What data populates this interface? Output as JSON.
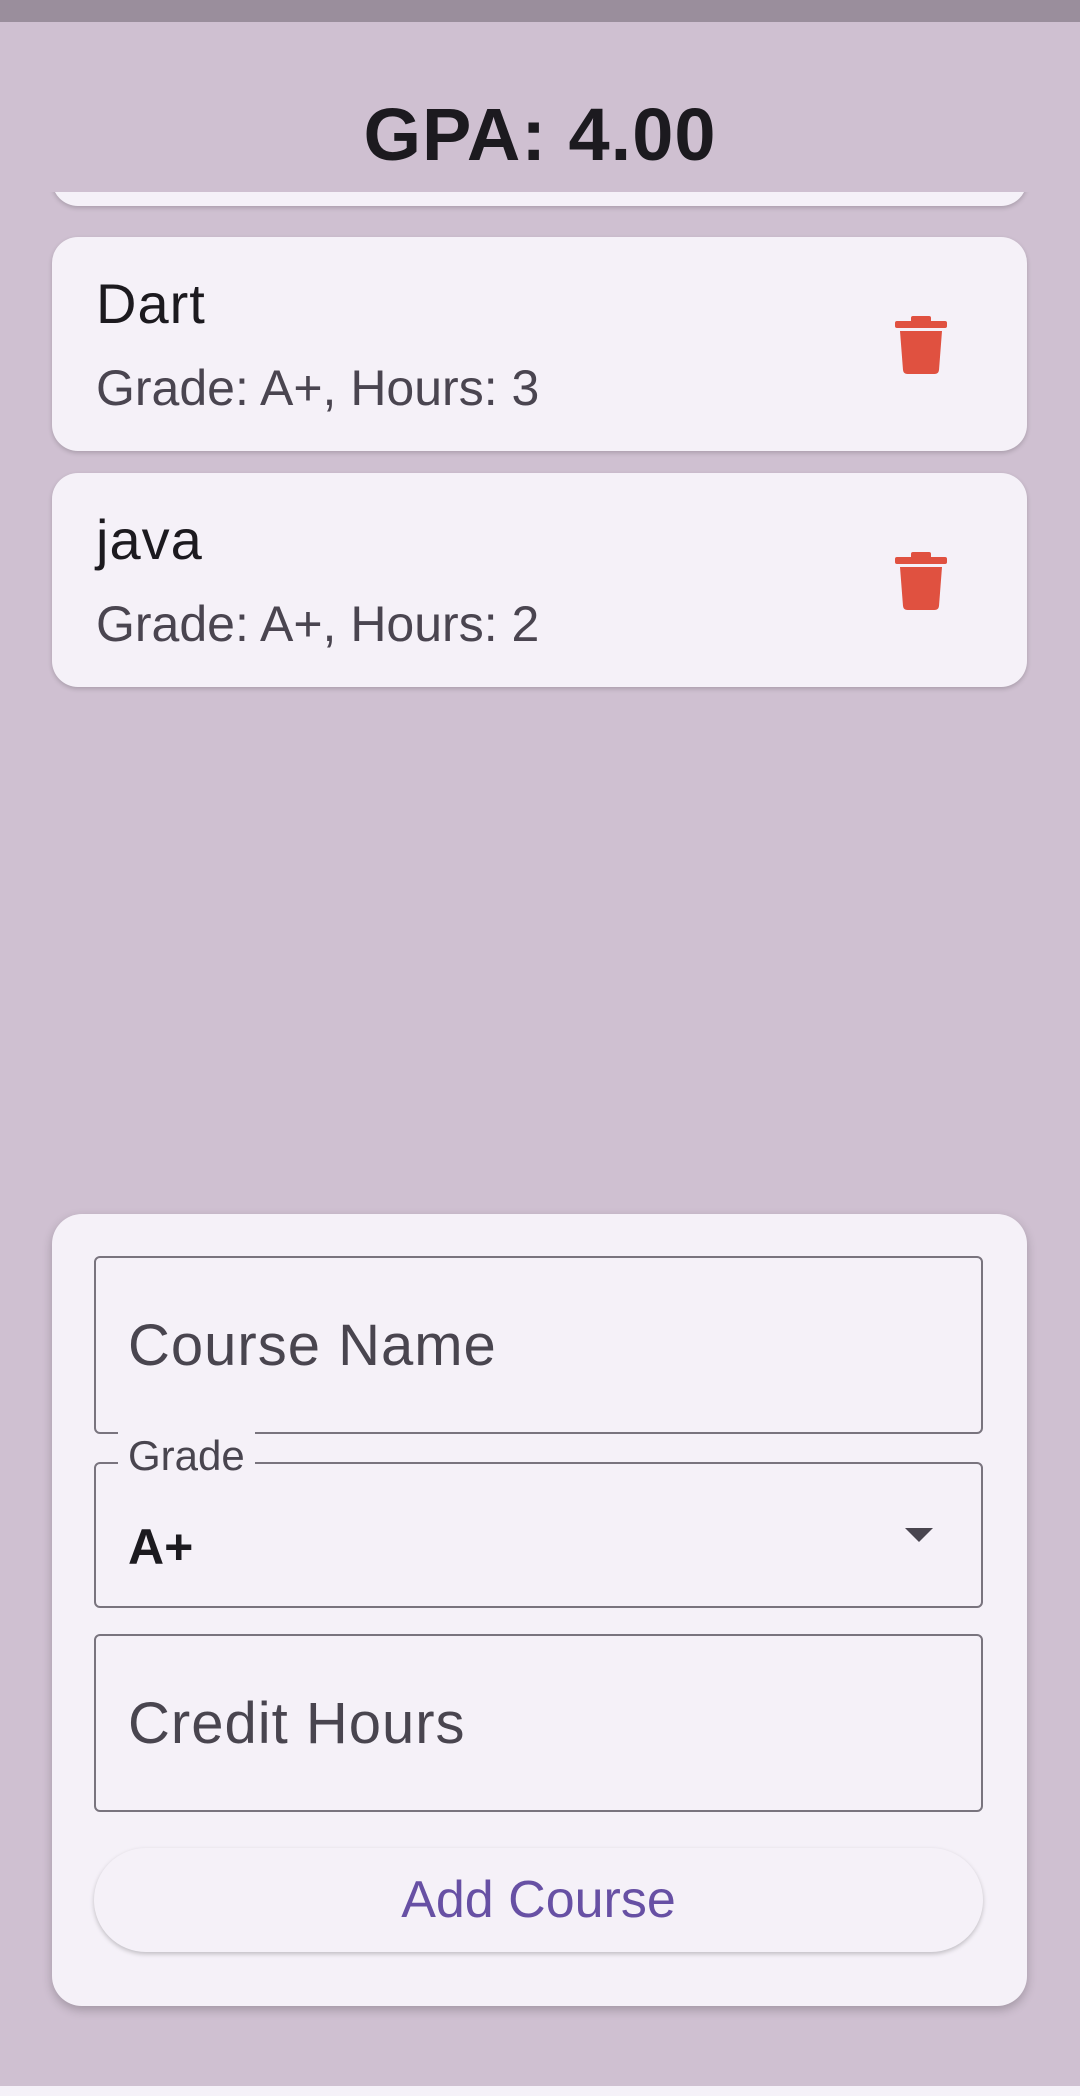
{
  "header": {
    "gpa_text": "GPA: 4.00"
  },
  "courses": [
    {
      "name": "Dart",
      "details": "Grade: A+, Hours: 3"
    },
    {
      "name": "java",
      "details": "Grade: A+, Hours: 2"
    }
  ],
  "form": {
    "course_name_placeholder": "Course Name",
    "grade_label": "Grade",
    "grade_value": "A+",
    "credit_hours_placeholder": "Credit Hours",
    "add_button_label": "Add Course"
  },
  "colors": {
    "background": "#cfc0d1",
    "card": "#f5f1f8",
    "delete": "#e05140",
    "accent": "#6750a4"
  },
  "icons": {
    "delete": "trash-icon",
    "dropdown": "caret-down-icon"
  }
}
